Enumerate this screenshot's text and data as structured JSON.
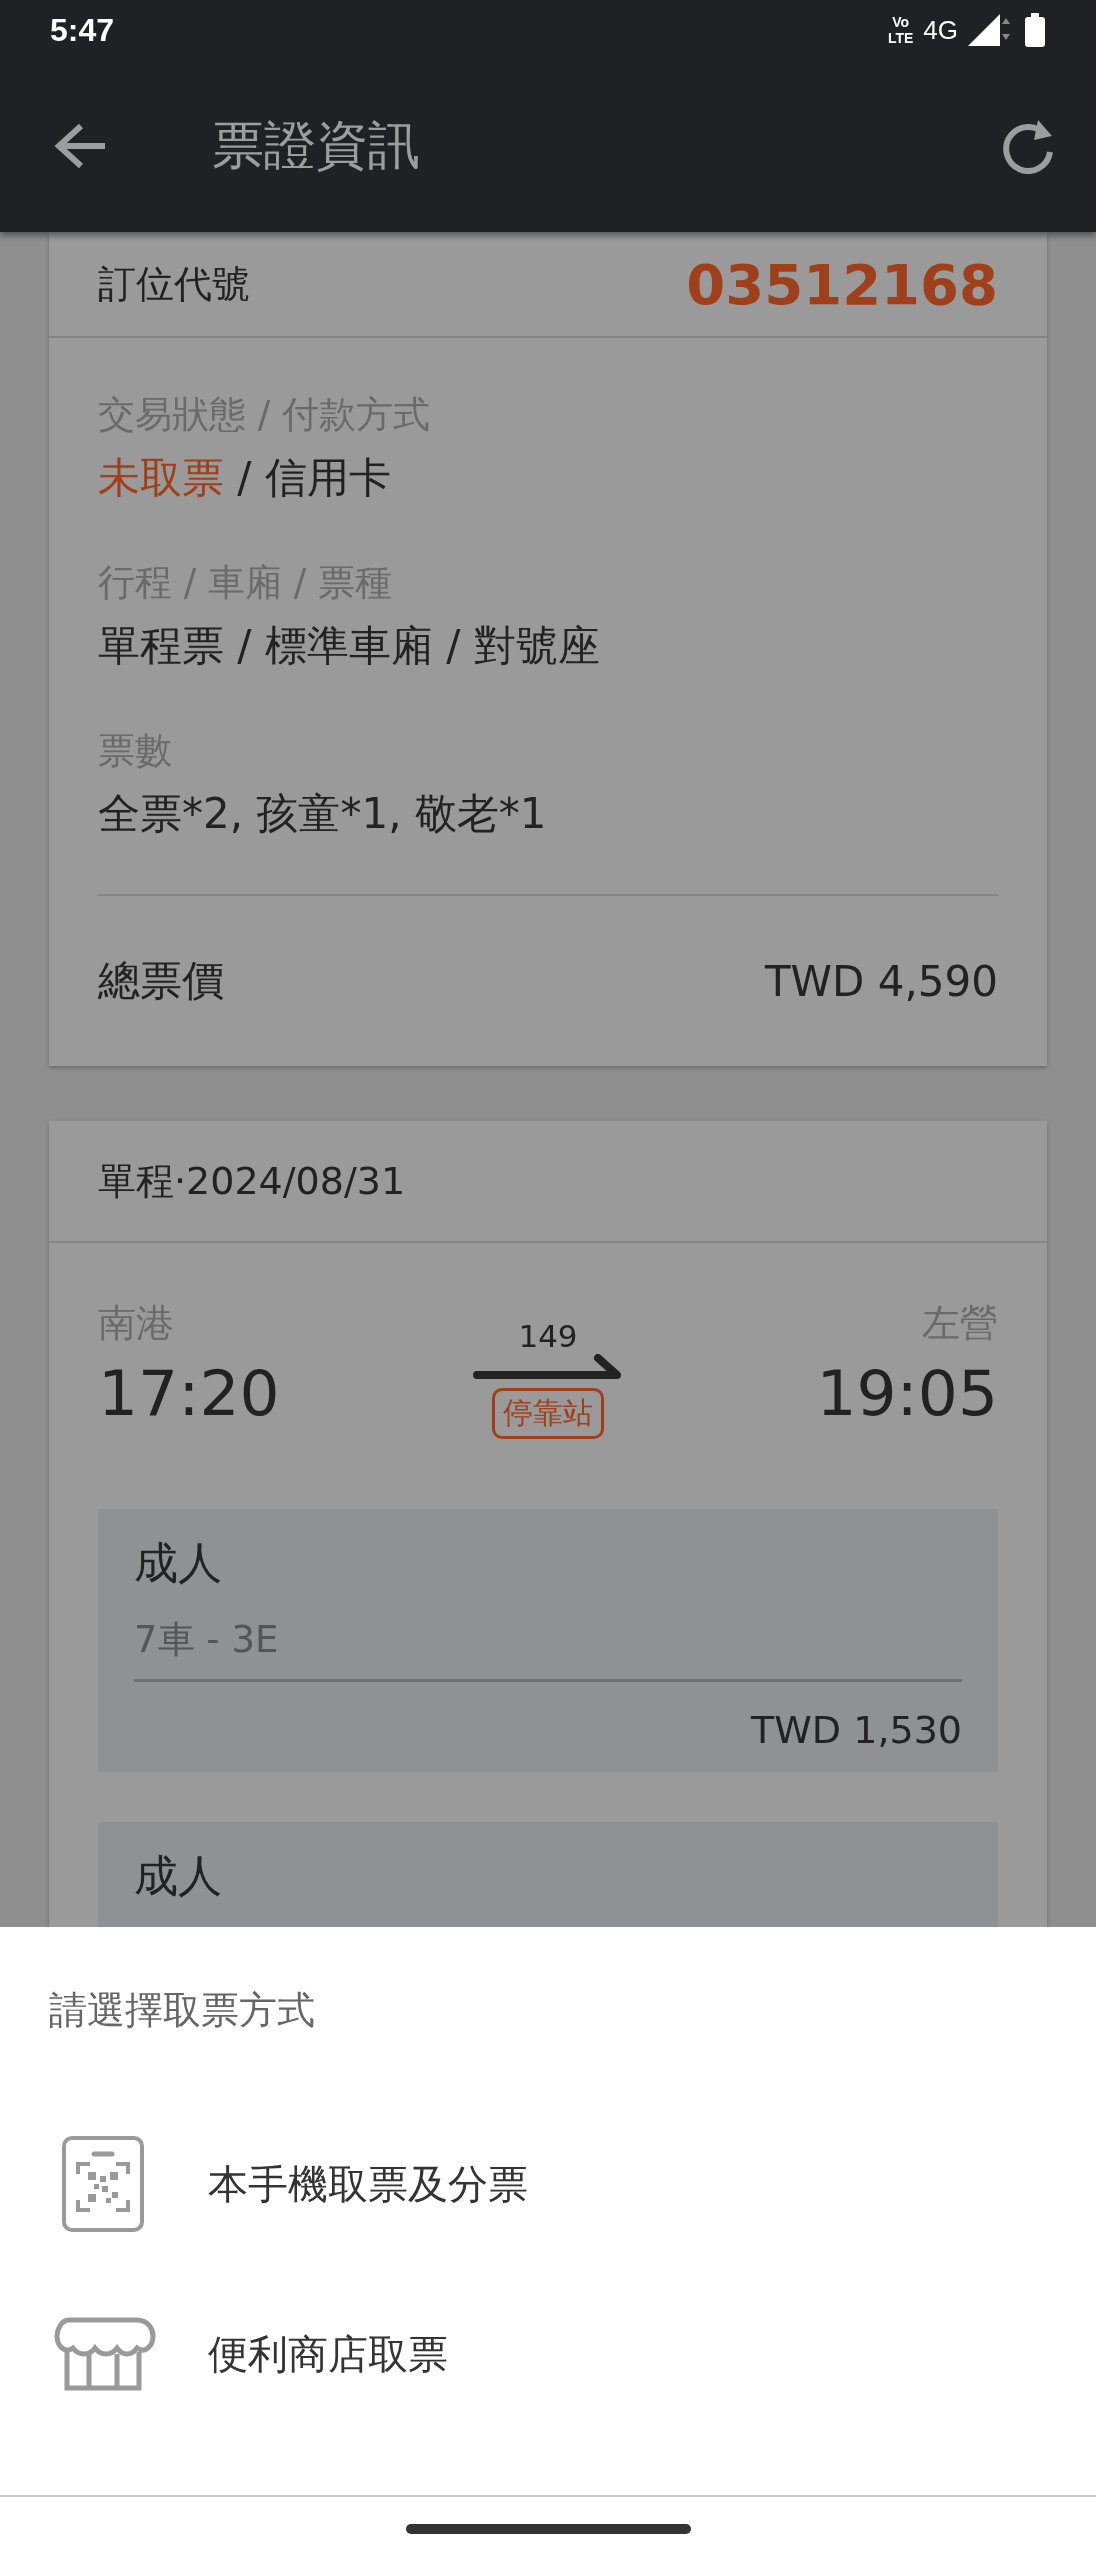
{
  "status_bar": {
    "time": "5:47",
    "volte": [
      "Vo",
      "LTE"
    ],
    "network": "4G"
  },
  "app_bar": {
    "title": "票證資訊"
  },
  "booking": {
    "code_label": "訂位代號",
    "code": "03512168",
    "fields": [
      {
        "label": "交易狀態 / 付款方式",
        "value": [
          {
            "text": "未取票",
            "highlight": true
          },
          {
            "text": " / 信用卡",
            "highlight": false
          }
        ]
      },
      {
        "label": "行程 / 車廂 / 票種",
        "value": [
          {
            "text": "單程票 / 標準車廂 / 對號座",
            "highlight": false
          }
        ]
      },
      {
        "label": "票數",
        "value": [
          {
            "text": "全票*2, 孩童*1, 敬老*1",
            "highlight": false
          }
        ]
      }
    ],
    "total_label": "總票價",
    "total": "TWD 4,590"
  },
  "trip": {
    "header": "單程·2024/08/31",
    "origin": {
      "station": "南港",
      "time": "17:20"
    },
    "destination": {
      "station": "左營",
      "time": "19:05"
    },
    "train_no": "149",
    "stop_type": "停靠站",
    "passengers": [
      {
        "type": "成人",
        "seat": "7車 - 3E",
        "price": "TWD 1,530"
      },
      {
        "type": "成人"
      }
    ]
  },
  "sheet": {
    "title": "請選擇取票方式",
    "options": [
      {
        "kind": "mobile",
        "label": "本手機取票及分票"
      },
      {
        "kind": "store",
        "label": "便利商店取票"
      }
    ]
  }
}
